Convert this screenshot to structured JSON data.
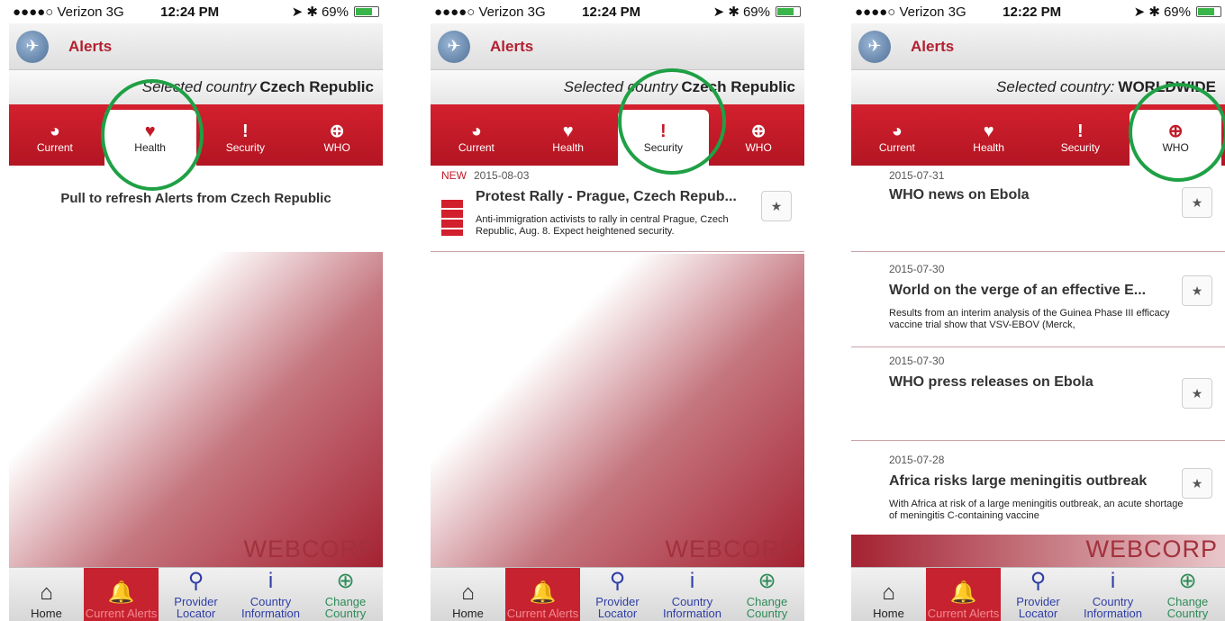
{
  "screens": [
    {
      "status": {
        "carrier": "●●●●○ Verizon  3G",
        "time": "12:24 PM",
        "battery": "69%"
      },
      "app_title": "Alerts",
      "country_label": "Selected country",
      "country_value": "Czech Republic",
      "tabs": [
        "Current",
        "Health",
        "Security",
        "WHO"
      ],
      "active_tab": "Health",
      "message": "Pull to refresh Alerts from Czech Republic"
    },
    {
      "status": {
        "carrier": "●●●●○ Verizon  3G",
        "time": "12:24 PM",
        "battery": "69%"
      },
      "app_title": "Alerts",
      "country_label": "Selected country",
      "country_value": "Czech Republic",
      "tabs": [
        "Current",
        "Health",
        "Security",
        "WHO"
      ],
      "active_tab": "Security",
      "alerts": [
        {
          "new": "NEW",
          "date": "2015-08-03",
          "title": "Protest Rally - Prague, Czech Repub...",
          "desc": "Anti-immigration activists to rally in central Prague, Czech Republic, Aug. 8. Expect heightened security."
        }
      ]
    },
    {
      "status": {
        "carrier": "●●●●○ Verizon  3G",
        "time": "12:22 PM",
        "battery": "69%"
      },
      "app_title": "Alerts",
      "country_label": "Selected country:",
      "country_value": "WORLDWIDE",
      "tabs": [
        "Current",
        "Health",
        "Security",
        "WHO"
      ],
      "active_tab": "WHO",
      "alerts": [
        {
          "date": "2015-07-31",
          "title": "WHO news on Ebola",
          "desc": ""
        },
        {
          "date": "2015-07-30",
          "title": "World on the verge of an effective E...",
          "desc": "Results from an interim analysis of the Guinea Phase III efficacy vaccine trial show that VSV-EBOV (Merck,"
        },
        {
          "date": "2015-07-30",
          "title": "WHO press releases on Ebola",
          "desc": ""
        },
        {
          "date": "2015-07-28",
          "title": "Africa risks large meningitis outbreak",
          "desc": "With Africa at risk of a large meningitis outbreak, an acute shortage of meningitis C-containing vaccine"
        }
      ]
    }
  ],
  "brand": "WEBCORP",
  "nav": [
    "Home",
    "Current Alerts",
    "Provider Locator",
    "Country Information",
    "Change Country"
  ],
  "icons": {
    "logo": "plane-globe-icon",
    "current": "pie-icon",
    "health": "heart-icon",
    "security": "exclamation-icon",
    "who": "globe-icon",
    "star": "star-icon"
  },
  "colors": {
    "accent": "#c21a28",
    "highlight": "#1fa045"
  }
}
